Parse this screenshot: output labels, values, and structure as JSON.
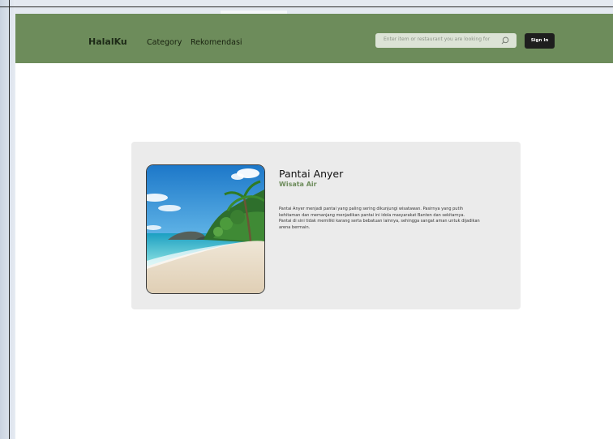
{
  "navbar": {
    "brand": "HalalKu",
    "links": [
      "Category",
      "Rekomendasi"
    ],
    "search_placeholder": "Enter item or restaurant you are looking for",
    "signin_label": "Sign In",
    "bg_color": "#6d8c5b"
  },
  "detail": {
    "title": "Pantai Anyer",
    "category": "Wisata Air",
    "description": [
      "Pantai Anyer menjadi pantai yang paling sering dikunjungi wisatawan. Pasirnya yang putih kehitaman dan memanjang menjadikan pantai ini idola masyarakat Banten dan sekitarnya.",
      "Pantai di sini tidak memiliki karang serta bebatuan lainnya, sehingga sangat aman untuk dijadikan arena bermain."
    ],
    "image_icon": "beach-photo"
  }
}
